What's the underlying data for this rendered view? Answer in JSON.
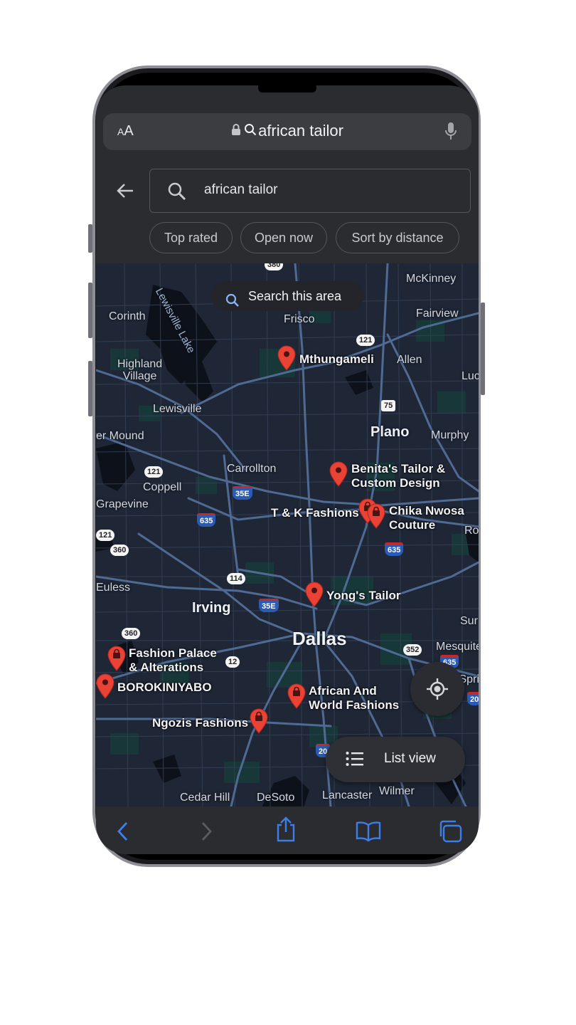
{
  "browser": {
    "text_size_label": "AA",
    "url_text": "african tailor"
  },
  "search": {
    "query": "african tailor",
    "chips": [
      "Top rated",
      "Open now",
      "Sort by distance"
    ],
    "search_area_label": "Search this area",
    "list_view_label": "List view"
  },
  "map": {
    "places": [
      {
        "name": "Corinth"
      },
      {
        "name": "Frisco"
      },
      {
        "name": "McKinney"
      },
      {
        "name": "Fairview"
      },
      {
        "name": "Allen"
      },
      {
        "name": "Highland\nVillage"
      },
      {
        "name": "Lewisville"
      },
      {
        "name": "Plano"
      },
      {
        "name": "Murphy"
      },
      {
        "name": "er Mound"
      },
      {
        "name": "Carrollton"
      },
      {
        "name": "Coppell"
      },
      {
        "name": "Grapevine"
      },
      {
        "name": "Euless"
      },
      {
        "name": "Irving"
      },
      {
        "name": "Dallas"
      },
      {
        "name": "Mesquite"
      },
      {
        "name": "Cedar Hill"
      },
      {
        "name": "DeSoto"
      },
      {
        "name": "Lancaster"
      },
      {
        "name": "Wilmer"
      },
      {
        "name": "Luc"
      },
      {
        "name": "Ro"
      },
      {
        "name": "Sur"
      },
      {
        "name": "Balch Springs"
      }
    ],
    "lake_label": "Lewisville Lake",
    "results": [
      {
        "name": "Mthungameli",
        "type": "place"
      },
      {
        "name": "Benita's Tailor &\nCustom Design",
        "type": "place"
      },
      {
        "name": "T & K Fashions",
        "type": "shop"
      },
      {
        "name": "Chika Nwosa\nCouture",
        "type": "shop"
      },
      {
        "name": "Yong's Tailor",
        "type": "place"
      },
      {
        "name": "Fashion Palace\n& Alterations",
        "type": "shop"
      },
      {
        "name": "BOROKINIYABO",
        "type": "place"
      },
      {
        "name": "African And\nWorld Fashions",
        "type": "shop"
      },
      {
        "name": "Ngozis Fashions",
        "type": "shop"
      }
    ],
    "route_shields": [
      "121",
      "75",
      "121",
      "35E",
      "635",
      "121",
      "360",
      "114",
      "35E",
      "360",
      "12",
      "352",
      "635",
      "635",
      "20",
      "20",
      "380"
    ],
    "pin_color": "#ea4335"
  },
  "toolbar": {
    "icons": [
      "back-icon",
      "forward-icon",
      "share-icon",
      "bookmarks-icon",
      "tabs-icon"
    ]
  }
}
